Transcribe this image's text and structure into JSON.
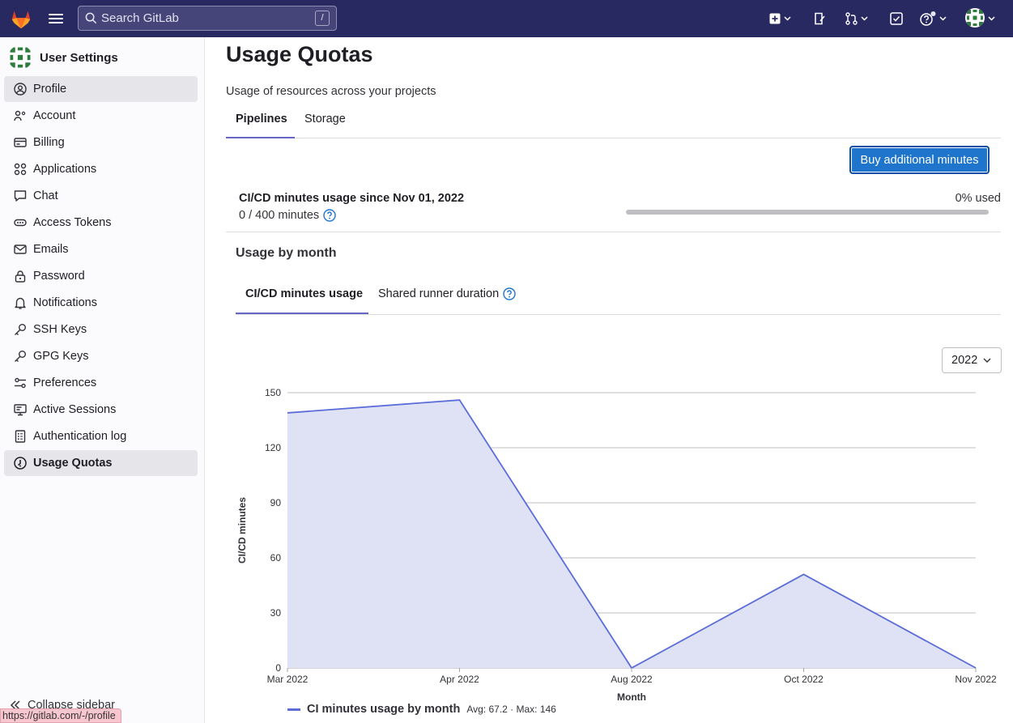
{
  "search": {
    "placeholder": "Search GitLab",
    "shortcut": "/"
  },
  "sidebar": {
    "title": "User Settings",
    "items": [
      {
        "label": "Profile",
        "icon": "profile-icon"
      },
      {
        "label": "Account",
        "icon": "account-icon"
      },
      {
        "label": "Billing",
        "icon": "billing-icon"
      },
      {
        "label": "Applications",
        "icon": "applications-icon"
      },
      {
        "label": "Chat",
        "icon": "chat-icon"
      },
      {
        "label": "Access Tokens",
        "icon": "token-icon"
      },
      {
        "label": "Emails",
        "icon": "email-icon"
      },
      {
        "label": "Password",
        "icon": "lock-icon"
      },
      {
        "label": "Notifications",
        "icon": "bell-icon"
      },
      {
        "label": "SSH Keys",
        "icon": "key-icon"
      },
      {
        "label": "GPG Keys",
        "icon": "key-icon"
      },
      {
        "label": "Preferences",
        "icon": "preferences-icon"
      },
      {
        "label": "Active Sessions",
        "icon": "monitor-icon"
      },
      {
        "label": "Authentication log",
        "icon": "log-icon"
      },
      {
        "label": "Usage Quotas",
        "icon": "quota-icon"
      }
    ],
    "collapse_label": "Collapse sidebar"
  },
  "status_url": "https://gitlab.com/-/profile",
  "page": {
    "title": "Usage Quotas",
    "description": "Usage of resources across your projects",
    "tabs": [
      "Pipelines",
      "Storage"
    ],
    "buy_button": "Buy additional minutes",
    "usage_title": "CI/CD minutes usage since Nov 01, 2022",
    "usage_count": "0 / 400 minutes",
    "percent_used": "0% used",
    "progress_fraction": 0,
    "by_month_title": "Usage by month",
    "sub_tabs": [
      "CI/CD minutes usage",
      "Shared runner duration"
    ],
    "year": "2022"
  },
  "colors": {
    "navbar": "#292961",
    "accent": "#6666c4",
    "button": "#1f75cb",
    "series": "#5b6dd8"
  },
  "chart_data": {
    "type": "area",
    "categories": [
      "Mar 2022",
      "Apr 2022",
      "Aug 2022",
      "Oct 2022",
      "Nov 2022"
    ],
    "series": [
      {
        "name": "CI minutes usage by month",
        "values": [
          139,
          146,
          0,
          51,
          0
        ]
      }
    ],
    "xlabel": "Month",
    "ylabel": "CI/CD minutes",
    "ylim": [
      0,
      150
    ],
    "yticks": [
      0,
      30,
      60,
      90,
      120,
      150
    ],
    "legend_stats": "Avg: 67.2 · Max: 146",
    "grid": true,
    "legend_position": "bottom-left"
  }
}
